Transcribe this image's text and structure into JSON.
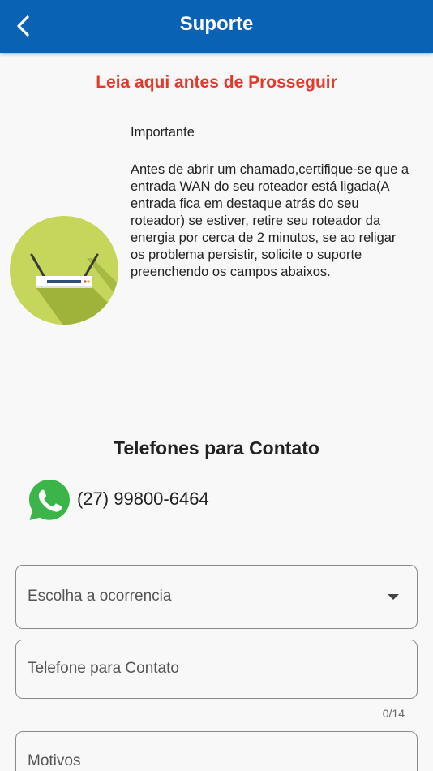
{
  "appbar": {
    "title": "Suporte",
    "back_icon": "chevron-left-icon"
  },
  "notice": {
    "heading": "Leia aqui antes de Prosseguir",
    "important": "Importante",
    "body": "Antes de abrir um chamado,certifique-se que a entrada WAN do seu roteador está ligada(A entrada fica em destaque atrás do seu roteador) se estiver, retire seu roteador da energia por cerca de 2 minutos, se ao religar os problema persistir, solicite o suporte preenchendo os campos abaixos.",
    "image_icon": "router-icon"
  },
  "contacts": {
    "title": "Telefones para Contato",
    "whatsapp_icon": "whatsapp-icon",
    "phone": "(27) 99800-6464"
  },
  "form": {
    "occurrence_label": "Escolha a ocorrencia",
    "phone_label": "Telefone para Contato",
    "phone_counter": "0/14",
    "reasons_label": "Motivos"
  },
  "colors": {
    "appbar": "#0a62b4",
    "warning": "#e4392a",
    "whatsapp": "#3bb54a",
    "router_circle": "#c5d65a"
  }
}
